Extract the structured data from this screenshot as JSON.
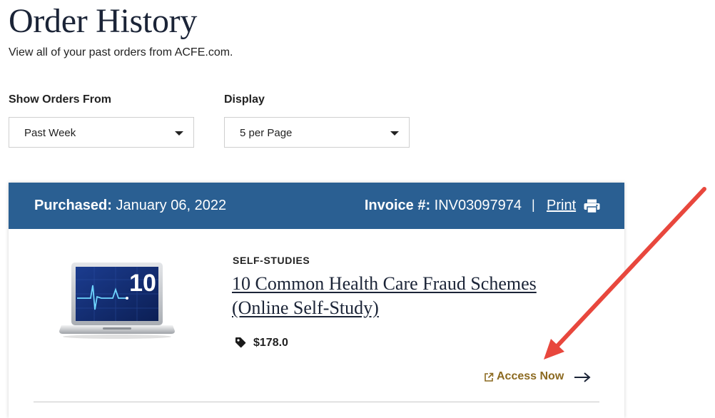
{
  "page": {
    "title": "Order History",
    "subtitle": "View all of your past orders from ACFE.com."
  },
  "filters": {
    "show_orders_from": {
      "label": "Show Orders From",
      "value": "Past Week"
    },
    "display": {
      "label": "Display",
      "value": "5 per Page"
    }
  },
  "order": {
    "purchased_label": "Purchased:",
    "purchased_date": "January 06, 2022",
    "invoice_label": "Invoice #:",
    "invoice_number": "INV03097974",
    "separator": "|",
    "print_label": "Print",
    "item": {
      "category": "SELF-STUDIES",
      "title": "10 Common Health Care Fraud Schemes (Online Self-Study)",
      "image_badge_text": "10",
      "price": "$178.0",
      "access_label": "Access Now"
    }
  },
  "colors": {
    "header_blue": "#2a5f92",
    "access_gold": "#8c6a21",
    "annotation_red": "#e8473d"
  },
  "icons": {
    "select_caret": "chevron-down-icon",
    "print": "printer-icon",
    "price": "tag-icon",
    "access": "external-link-icon",
    "access_arrow": "arrow-right-icon"
  }
}
